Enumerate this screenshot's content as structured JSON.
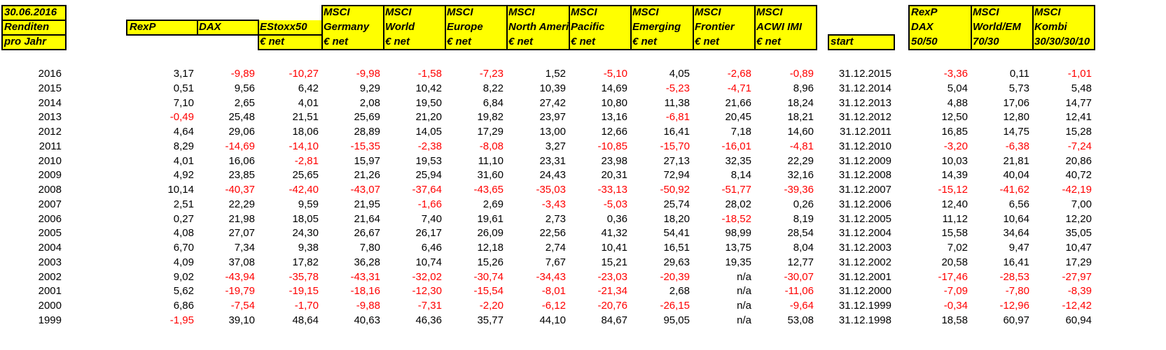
{
  "sheet": {
    "corner": [
      "30.06.2016",
      "Renditen",
      "pro Jahr"
    ],
    "headers": [
      {
        "id": "rexp",
        "lines": [
          "",
          "RexP",
          ""
        ]
      },
      {
        "id": "dax",
        "lines": [
          "",
          "DAX",
          ""
        ]
      },
      {
        "id": "estoxx50",
        "lines": [
          "",
          "EStoxx50",
          "€ net"
        ]
      },
      {
        "id": "msci_germany",
        "lines": [
          "MSCI",
          "Germany",
          "€ net"
        ]
      },
      {
        "id": "msci_world",
        "lines": [
          "MSCI",
          "World",
          "€ net"
        ]
      },
      {
        "id": "msci_europe",
        "lines": [
          "MSCI",
          "Europe",
          "€ net"
        ]
      },
      {
        "id": "msci_north_america",
        "lines": [
          "MSCI",
          "North Ameri",
          "€ net"
        ]
      },
      {
        "id": "msci_pacific",
        "lines": [
          "MSCI",
          "Pacific",
          "€ net"
        ]
      },
      {
        "id": "msci_emerging",
        "lines": [
          "MSCI",
          "Emerging",
          "€ net"
        ]
      },
      {
        "id": "msci_frontier",
        "lines": [
          "MSCI",
          "Frontier",
          "€ net"
        ]
      },
      {
        "id": "msci_acwi_imi",
        "lines": [
          "MSCI",
          "ACWI IMI",
          "€ net"
        ]
      },
      {
        "id": "start",
        "lines": [
          "",
          "",
          "start"
        ]
      },
      {
        "id": "rexp_dax",
        "lines": [
          "RexP",
          "DAX",
          "50/50"
        ]
      },
      {
        "id": "msci_world_em",
        "lines": [
          "MSCI",
          "World/EM",
          "70/30"
        ]
      },
      {
        "id": "msci_kombi",
        "lines": [
          "MSCI",
          "Kombi",
          "30/30/30/10"
        ]
      }
    ],
    "rows": [
      {
        "year": "2016",
        "values": [
          "3,17",
          "-9,89",
          "-10,27",
          "-9,98",
          "-1,58",
          "-7,23",
          "1,52",
          "-5,10",
          "4,05",
          "-2,68",
          "-0,89"
        ],
        "start": "31.12.2015",
        "combos": [
          "-3,36",
          "0,11",
          "-1,01"
        ]
      },
      {
        "year": "2015",
        "values": [
          "0,51",
          "9,56",
          "6,42",
          "9,29",
          "10,42",
          "8,22",
          "10,39",
          "14,69",
          "-5,23",
          "-4,71",
          "8,96"
        ],
        "start": "31.12.2014",
        "combos": [
          "5,04",
          "5,73",
          "5,48"
        ]
      },
      {
        "year": "2014",
        "values": [
          "7,10",
          "2,65",
          "4,01",
          "2,08",
          "19,50",
          "6,84",
          "27,42",
          "10,80",
          "11,38",
          "21,66",
          "18,24"
        ],
        "start": "31.12.2013",
        "combos": [
          "4,88",
          "17,06",
          "14,77"
        ]
      },
      {
        "year": "2013",
        "values": [
          "-0,49",
          "25,48",
          "21,51",
          "25,69",
          "21,20",
          "19,82",
          "23,97",
          "13,16",
          "-6,81",
          "20,45",
          "18,21"
        ],
        "start": "31.12.2012",
        "combos": [
          "12,50",
          "12,80",
          "12,41"
        ]
      },
      {
        "year": "2012",
        "values": [
          "4,64",
          "29,06",
          "18,06",
          "28,89",
          "14,05",
          "17,29",
          "13,00",
          "12,66",
          "16,41",
          "7,18",
          "14,60"
        ],
        "start": "31.12.2011",
        "combos": [
          "16,85",
          "14,75",
          "15,28"
        ]
      },
      {
        "year": "2011",
        "values": [
          "8,29",
          "-14,69",
          "-14,10",
          "-15,35",
          "-2,38",
          "-8,08",
          "3,27",
          "-10,85",
          "-15,70",
          "-16,01",
          "-4,81"
        ],
        "start": "31.12.2010",
        "combos": [
          "-3,20",
          "-6,38",
          "-7,24"
        ]
      },
      {
        "year": "2010",
        "values": [
          "4,01",
          "16,06",
          "-2,81",
          "15,97",
          "19,53",
          "11,10",
          "23,31",
          "23,98",
          "27,13",
          "32,35",
          "22,29"
        ],
        "start": "31.12.2009",
        "combos": [
          "10,03",
          "21,81",
          "20,86"
        ]
      },
      {
        "year": "2009",
        "values": [
          "4,92",
          "23,85",
          "25,65",
          "21,26",
          "25,94",
          "31,60",
          "24,43",
          "20,31",
          "72,94",
          "8,14",
          "32,16"
        ],
        "start": "31.12.2008",
        "combos": [
          "14,39",
          "40,04",
          "40,72"
        ]
      },
      {
        "year": "2008",
        "values": [
          "10,14",
          "-40,37",
          "-42,40",
          "-43,07",
          "-37,64",
          "-43,65",
          "-35,03",
          "-33,13",
          "-50,92",
          "-51,77",
          "-39,36"
        ],
        "start": "31.12.2007",
        "combos": [
          "-15,12",
          "-41,62",
          "-42,19"
        ]
      },
      {
        "year": "2007",
        "values": [
          "2,51",
          "22,29",
          "9,59",
          "21,95",
          "-1,66",
          "2,69",
          "-3,43",
          "-5,03",
          "25,74",
          "28,02",
          "0,26"
        ],
        "start": "31.12.2006",
        "combos": [
          "12,40",
          "6,56",
          "7,00"
        ]
      },
      {
        "year": "2006",
        "values": [
          "0,27",
          "21,98",
          "18,05",
          "21,64",
          "7,40",
          "19,61",
          "2,73",
          "0,36",
          "18,20",
          "-18,52",
          "8,19"
        ],
        "start": "31.12.2005",
        "combos": [
          "11,12",
          "10,64",
          "12,20"
        ]
      },
      {
        "year": "2005",
        "values": [
          "4,08",
          "27,07",
          "24,30",
          "26,67",
          "26,17",
          "26,09",
          "22,56",
          "41,32",
          "54,41",
          "98,99",
          "28,54"
        ],
        "start": "31.12.2004",
        "combos": [
          "15,58",
          "34,64",
          "35,05"
        ]
      },
      {
        "year": "2004",
        "values": [
          "6,70",
          "7,34",
          "9,38",
          "7,80",
          "6,46",
          "12,18",
          "2,74",
          "10,41",
          "16,51",
          "13,75",
          "8,04"
        ],
        "start": "31.12.2003",
        "combos": [
          "7,02",
          "9,47",
          "10,47"
        ]
      },
      {
        "year": "2003",
        "values": [
          "4,09",
          "37,08",
          "17,82",
          "36,28",
          "10,74",
          "15,26",
          "7,67",
          "15,21",
          "29,63",
          "19,35",
          "12,77"
        ],
        "start": "31.12.2002",
        "combos": [
          "20,58",
          "16,41",
          "17,29"
        ]
      },
      {
        "year": "2002",
        "values": [
          "9,02",
          "-43,94",
          "-35,78",
          "-43,31",
          "-32,02",
          "-30,74",
          "-34,43",
          "-23,03",
          "-20,39",
          "n/a",
          "-30,07"
        ],
        "start": "31.12.2001",
        "combos": [
          "-17,46",
          "-28,53",
          "-27,97"
        ]
      },
      {
        "year": "2001",
        "values": [
          "5,62",
          "-19,79",
          "-19,15",
          "-18,16",
          "-12,30",
          "-15,54",
          "-8,01",
          "-21,34",
          "2,68",
          "n/a",
          "-11,06"
        ],
        "start": "31.12.2000",
        "combos": [
          "-7,09",
          "-7,80",
          "-8,39"
        ]
      },
      {
        "year": "2000",
        "values": [
          "6,86",
          "-7,54",
          "-1,70",
          "-9,88",
          "-7,31",
          "-2,20",
          "-6,12",
          "-20,76",
          "-26,15",
          "n/a",
          "-9,64"
        ],
        "start": "31.12.1999",
        "combos": [
          "-0,34",
          "-12,96",
          "-12,42"
        ]
      },
      {
        "year": "1999",
        "values": [
          "-1,95",
          "39,10",
          "48,64",
          "40,63",
          "46,36",
          "35,77",
          "44,10",
          "84,67",
          "95,05",
          "n/a",
          "53,08"
        ],
        "start": "31.12.1998",
        "combos": [
          "18,58",
          "60,97",
          "60,94"
        ]
      }
    ]
  },
  "colors": {
    "header_fill": "#ffff00",
    "negative": "#ff0000",
    "text": "#000000",
    "border": "#000000"
  }
}
